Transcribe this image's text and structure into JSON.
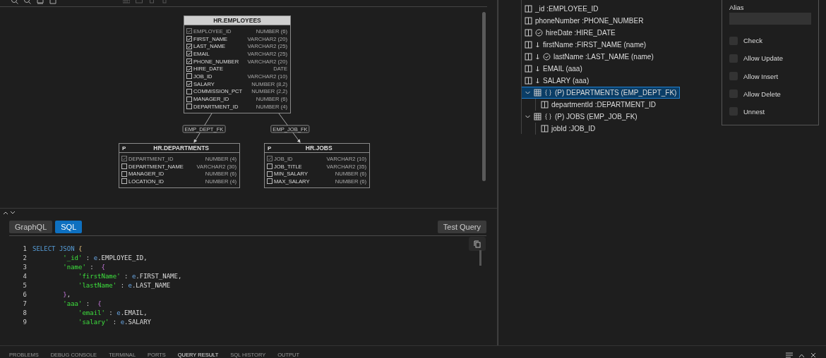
{
  "diagram": {
    "tables": [
      {
        "title": "HR.EMPLOYEES",
        "selected": true,
        "columns": [
          {
            "name": "EMPLOYEE_ID",
            "type": "NUMBER (6)",
            "checked": true,
            "disabled": true
          },
          {
            "name": "FIRST_NAME",
            "type": "VARCHAR2 (20)",
            "checked": true,
            "disabled": false
          },
          {
            "name": "LAST_NAME",
            "type": "VARCHAR2 (25)",
            "checked": true,
            "disabled": false
          },
          {
            "name": "EMAIL",
            "type": "VARCHAR2 (25)",
            "checked": true,
            "disabled": false
          },
          {
            "name": "PHONE_NUMBER",
            "type": "VARCHAR2 (20)",
            "checked": true,
            "disabled": false
          },
          {
            "name": "HIRE_DATE",
            "type": "DATE",
            "checked": true,
            "disabled": false
          },
          {
            "name": "JOB_ID",
            "type": "VARCHAR2 (10)",
            "checked": false,
            "disabled": false
          },
          {
            "name": "SALARY",
            "type": "NUMBER (8,2)",
            "checked": true,
            "disabled": false
          },
          {
            "name": "COMMISSION_PCT",
            "type": "NUMBER (2,2)",
            "checked": false,
            "disabled": false
          },
          {
            "name": "MANAGER_ID",
            "type": "NUMBER (6)",
            "checked": false,
            "disabled": false
          },
          {
            "name": "DEPARTMENT_ID",
            "type": "NUMBER (4)",
            "checked": false,
            "disabled": false
          }
        ]
      },
      {
        "title": "HR.DEPARTMENTS",
        "badge": "P",
        "selected": false,
        "columns": [
          {
            "name": "DEPARTMENT_ID",
            "type": "NUMBER (4)",
            "checked": true,
            "disabled": true
          },
          {
            "name": "DEPARTMENT_NAME",
            "type": "VARCHAR2 (30)",
            "checked": false,
            "disabled": false
          },
          {
            "name": "MANAGER_ID",
            "type": "NUMBER (6)",
            "checked": false,
            "disabled": false
          },
          {
            "name": "LOCATION_ID",
            "type": "NUMBER (4)",
            "checked": false,
            "disabled": false
          }
        ]
      },
      {
        "title": "HR.JOBS",
        "badge": "P",
        "selected": false,
        "columns": [
          {
            "name": "JOB_ID",
            "type": "VARCHAR2 (10)",
            "checked": true,
            "disabled": true
          },
          {
            "name": "JOB_TITLE",
            "type": "VARCHAR2 (35)",
            "checked": false,
            "disabled": false
          },
          {
            "name": "MIN_SALARY",
            "type": "NUMBER (6)",
            "checked": false,
            "disabled": false
          },
          {
            "name": "MAX_SALARY",
            "type": "NUMBER (6)",
            "checked": false,
            "disabled": false
          }
        ]
      }
    ],
    "relations": [
      {
        "label": "EMP_DEPT_FK"
      },
      {
        "label": "EMP_JOB_FK"
      }
    ]
  },
  "query": {
    "tabs": [
      {
        "label": "GraphQL",
        "selected": false
      },
      {
        "label": "SQL",
        "selected": true
      }
    ],
    "test_button": "Test Query",
    "lines": [
      {
        "number": "1",
        "tokens": [
          {
            "kind": "keyword",
            "text": "SELECT JSON "
          },
          {
            "kind": "brace",
            "text": "{"
          }
        ]
      },
      {
        "number": "2",
        "tokens": [
          {
            "kind": "string",
            "text": "        '_id'"
          },
          {
            "kind": "plain",
            "text": " : "
          },
          {
            "kind": "alias",
            "text": "e"
          },
          {
            "kind": "plain",
            "text": ".EMPLOYEE_ID,"
          }
        ]
      },
      {
        "number": "3",
        "tokens": [
          {
            "kind": "string",
            "text": "        'name'"
          },
          {
            "kind": "plain",
            "text": " :  "
          },
          {
            "kind": "brace2",
            "text": "{"
          }
        ]
      },
      {
        "number": "4",
        "tokens": [
          {
            "kind": "string",
            "text": "            'firstName'"
          },
          {
            "kind": "plain",
            "text": " : "
          },
          {
            "kind": "alias",
            "text": "e"
          },
          {
            "kind": "plain",
            "text": ".FIRST_NAME,"
          }
        ]
      },
      {
        "number": "5",
        "tokens": [
          {
            "kind": "string",
            "text": "            'lastName'"
          },
          {
            "kind": "plain",
            "text": " : "
          },
          {
            "kind": "alias",
            "text": "e"
          },
          {
            "kind": "plain",
            "text": ".LAST_NAME"
          }
        ]
      },
      {
        "number": "6",
        "tokens": [
          {
            "kind": "brace2",
            "text": "        }"
          },
          {
            "kind": "plain",
            "text": ","
          }
        ]
      },
      {
        "number": "7",
        "tokens": [
          {
            "kind": "string",
            "text": "        'aaa'"
          },
          {
            "kind": "plain",
            "text": " :  "
          },
          {
            "kind": "brace2",
            "text": "{"
          }
        ]
      },
      {
        "number": "8",
        "tokens": [
          {
            "kind": "string",
            "text": "            'email'"
          },
          {
            "kind": "plain",
            "text": " : "
          },
          {
            "kind": "alias",
            "text": "e"
          },
          {
            "kind": "plain",
            "text": ".EMAIL,"
          }
        ]
      },
      {
        "number": "9",
        "tokens": [
          {
            "kind": "string",
            "text": "            'salary'"
          },
          {
            "kind": "plain",
            "text": " : "
          },
          {
            "kind": "alias",
            "text": "e"
          },
          {
            "kind": "plain",
            "text": ".SALARY"
          }
        ]
      }
    ]
  },
  "tree": {
    "items": [
      {
        "kind": "column",
        "label": "_id :EMPLOYEE_ID",
        "arrow": false,
        "verified": false,
        "selected": false
      },
      {
        "kind": "column",
        "label": "phoneNumber :PHONE_NUMBER",
        "arrow": false,
        "verified": false,
        "selected": false
      },
      {
        "kind": "column",
        "label": "hireDate :HIRE_DATE",
        "arrow": false,
        "verified": true,
        "selected": false
      },
      {
        "kind": "column",
        "label": "firstName :FIRST_NAME (name)",
        "arrow": true,
        "verified": false,
        "selected": false
      },
      {
        "kind": "column",
        "label": "lastName :LAST_NAME (name)",
        "arrow": true,
        "verified": true,
        "selected": false
      },
      {
        "kind": "column",
        "label": "EMAIL (aaa)",
        "arrow": true,
        "verified": false,
        "selected": false
      },
      {
        "kind": "column",
        "label": "SALARY (aaa)",
        "arrow": true,
        "verified": false,
        "selected": false
      },
      {
        "kind": "table",
        "label": "(P) DEPARTMENTS (EMP_DEPT_FK)",
        "expanded": true,
        "selected": true,
        "children": [
          {
            "kind": "column",
            "label": "departmentId :DEPARTMENT_ID",
            "arrow": false,
            "verified": false,
            "selected": false
          }
        ]
      },
      {
        "kind": "table",
        "label": "(P) JOBS (EMP_JOB_FK)",
        "expanded": true,
        "selected": false,
        "children": [
          {
            "kind": "column",
            "label": "jobId :JOB_ID",
            "arrow": false,
            "verified": false,
            "selected": false
          }
        ]
      }
    ]
  },
  "properties": {
    "alias_label": "Alias",
    "options": [
      {
        "label": "Check",
        "checked": false
      },
      {
        "label": "Allow Update",
        "checked": false
      },
      {
        "label": "Allow Insert",
        "checked": false
      },
      {
        "label": "Allow Delete",
        "checked": false
      },
      {
        "label": "Unnest",
        "checked": false
      }
    ]
  },
  "bottom_tabs": [
    {
      "label": "PROBLEMS",
      "selected": false
    },
    {
      "label": "DEBUG CONSOLE",
      "selected": false
    },
    {
      "label": "TERMINAL",
      "selected": false
    },
    {
      "label": "PORTS",
      "selected": false
    },
    {
      "label": "QUERY RESULT",
      "selected": true
    },
    {
      "label": "SQL HISTORY",
      "selected": false
    },
    {
      "label": "OUTPUT",
      "selected": false
    }
  ]
}
